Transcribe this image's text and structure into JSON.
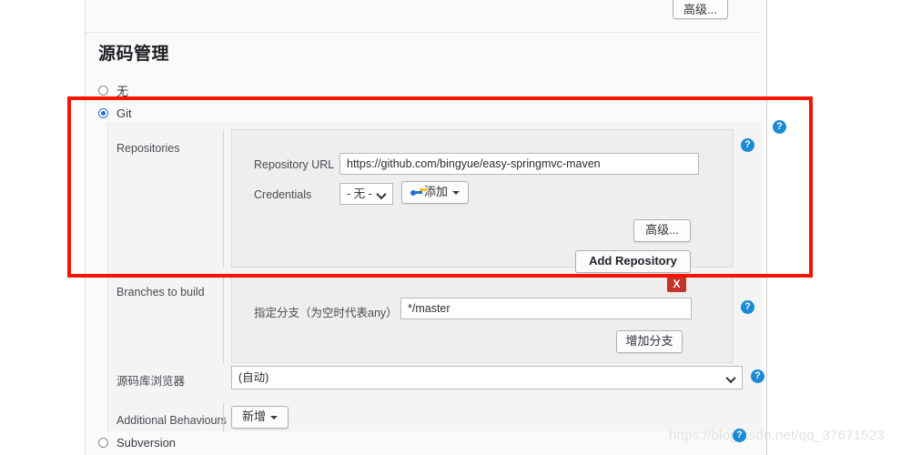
{
  "top": {
    "advanced_button": "高级..."
  },
  "section": {
    "title": "源码管理"
  },
  "scm_options": {
    "none": "无",
    "git": "Git",
    "subversion": "Subversion"
  },
  "repositories": {
    "label": "Repositories",
    "url_label": "Repository URL",
    "url_value": "https://github.com/bingyue/easy-springmvc-maven",
    "credentials_label": "Credentials",
    "credentials_value": "- 无 -",
    "add_credentials_button": "添加",
    "advanced_button": "高级...",
    "add_repository_button": "Add Repository",
    "help_icon": "?"
  },
  "branches": {
    "label": "Branches to build",
    "spec_label": "指定分支（为空时代表any）",
    "spec_value": "*/master",
    "add_branch_button": "增加分支",
    "delete_badge": "X",
    "help_icon": "?"
  },
  "repo_browser": {
    "label": "源码库浏览器",
    "value": "(自动)",
    "help_icon": "?"
  },
  "additional_behaviours": {
    "label": "Additional Behaviours",
    "add_button": "新增"
  },
  "annotation": {
    "highlight_color": "#f51500"
  },
  "watermark": {
    "text": "https://blog.csdn.net/qq_37671523",
    "badge": "?"
  }
}
